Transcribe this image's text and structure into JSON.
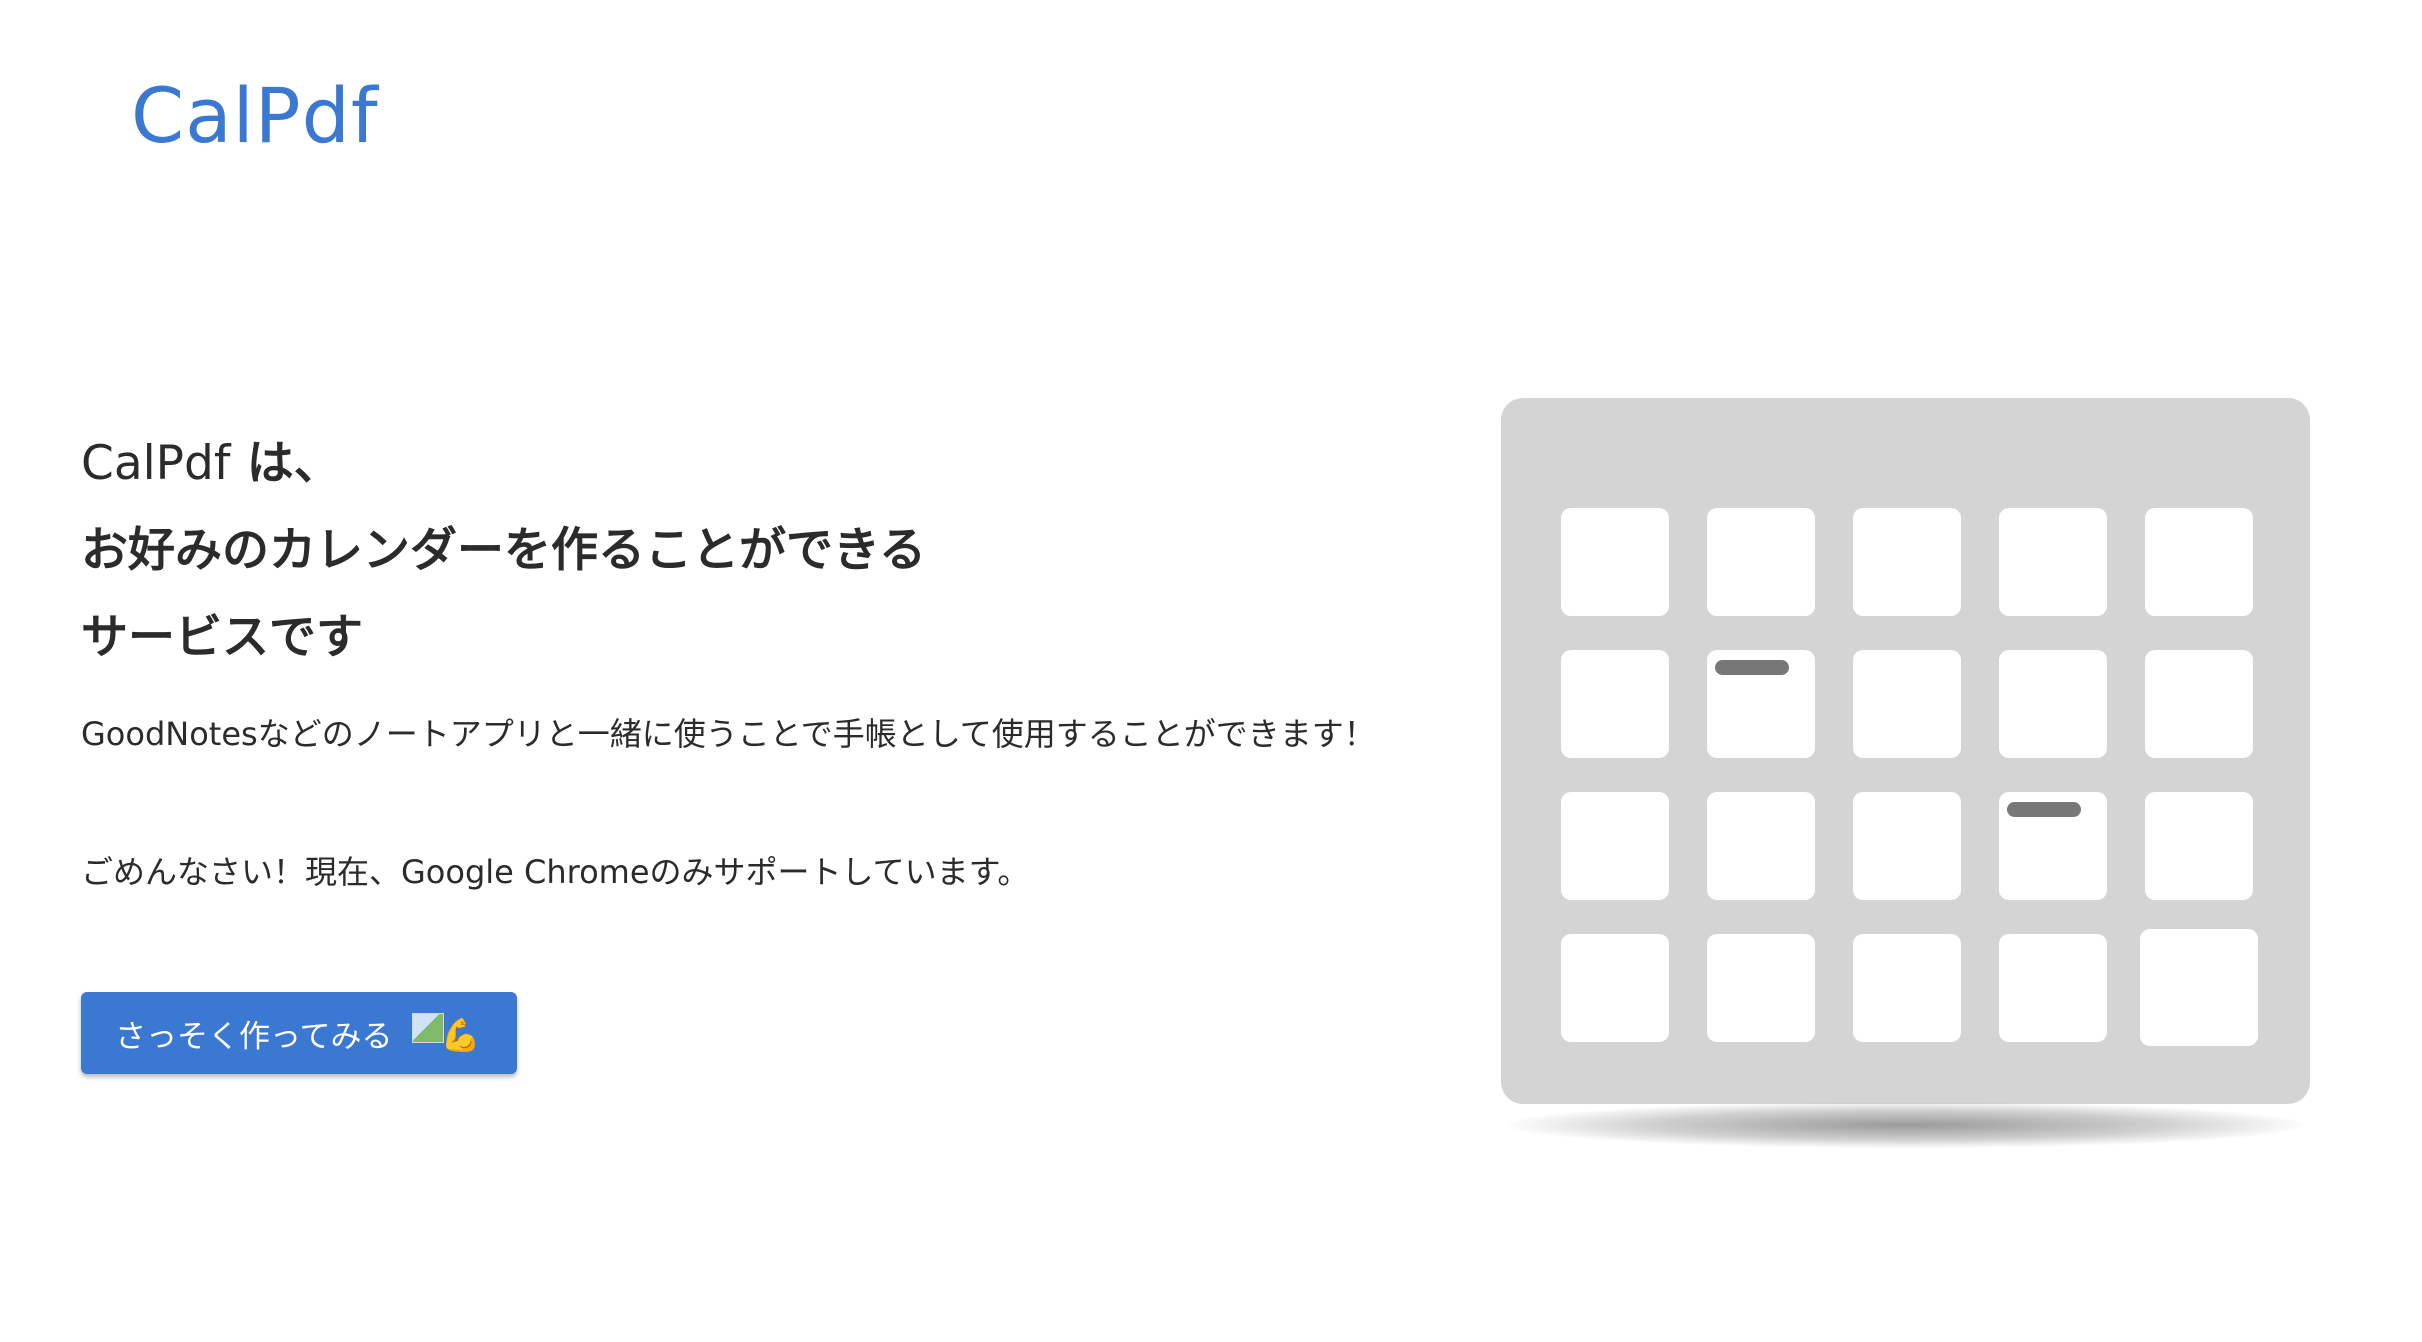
{
  "header": {
    "logo_text": "CalPdf"
  },
  "hero": {
    "headline": {
      "brand": "CalPdf",
      "line1_suffix": " は、",
      "line2": "お好みのカレンダーを作ることができる",
      "line3": "サービスです"
    },
    "description": "GoodNotesなどのノートアプリと一緒に使うことで手帳として使用することができます！",
    "notice": "ごめんなさい！現在、Google Chromeのみサポートしています。",
    "cta": {
      "label": "さっそく作ってみる",
      "emoji": "💪"
    }
  },
  "calendar_illustration": {
    "rows": 4,
    "columns": 5,
    "cells_with_events": [
      {
        "row": 2,
        "column": 2
      },
      {
        "row": 3,
        "column": 4
      }
    ]
  },
  "colors": {
    "brand": "#3a78d1",
    "text": "#2b2b2b",
    "calendar_bg": "#d4d4d4",
    "event_bar": "#777777"
  }
}
